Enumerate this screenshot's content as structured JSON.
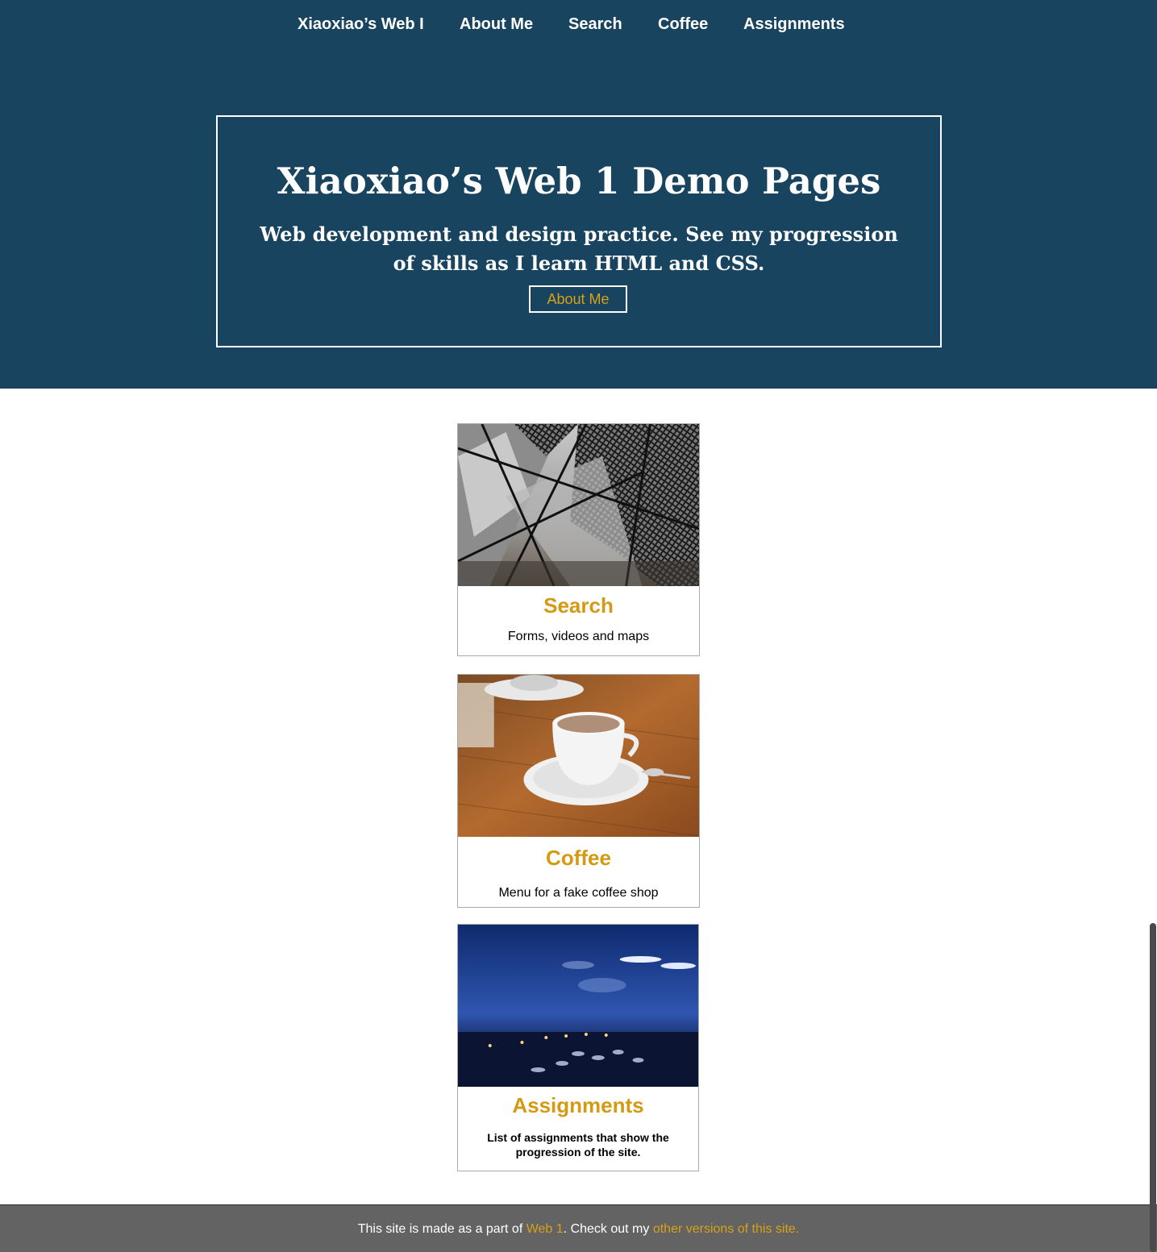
{
  "nav": {
    "items": [
      {
        "label": "Xiaoxiao’s Web I"
      },
      {
        "label": "About Me"
      },
      {
        "label": "Search"
      },
      {
        "label": "Coffee"
      },
      {
        "label": "Assignments"
      }
    ]
  },
  "hero": {
    "title": "Xiaoxiao’s Web 1 Demo Pages",
    "subtitle": "Web development and design practice. See my progression of skills as I learn HTML and CSS.",
    "button_label": "About Me"
  },
  "cards": [
    {
      "title": "Search",
      "description": "Forms, videos and maps",
      "image": "metal-mesh-structure-photo"
    },
    {
      "title": "Coffee",
      "description": "Menu for a fake coffee shop",
      "image": "coffee-cup-photo"
    },
    {
      "title": "Assignments",
      "description": "List of assignments that show the progression of the site.",
      "image": "harbor-at-night-photo"
    }
  ],
  "footer": {
    "text_before": "This site is made as a part of ",
    "link1": "Web 1",
    "text_middle": ". Check out my ",
    "link2": "other versions of this site."
  },
  "colors": {
    "header_bg": "#19445f",
    "accent": "#d39a12",
    "footer_bg": "#636363"
  }
}
